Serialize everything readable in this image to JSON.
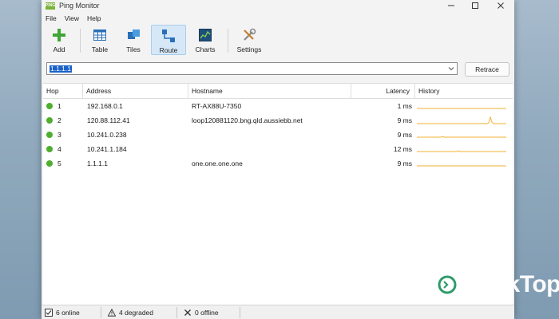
{
  "window": {
    "title": "Ping Monitor",
    "logo_text": "PING"
  },
  "menu": [
    "File",
    "View",
    "Help"
  ],
  "toolbar": [
    {
      "label": "Add",
      "icon": "plus-icon"
    },
    {
      "label": "Table",
      "icon": "table-icon"
    },
    {
      "label": "Tiles",
      "icon": "tiles-icon"
    },
    {
      "label": "Route",
      "icon": "route-icon",
      "active": true
    },
    {
      "label": "Charts",
      "icon": "chart-icon"
    },
    {
      "label": "Settings",
      "icon": "tools-icon"
    }
  ],
  "address_bar": {
    "value": "1.1.1.1",
    "retrace_label": "Retrace"
  },
  "columns": {
    "hop": "Hop",
    "address": "Address",
    "hostname": "Hostname",
    "latency": "Latency",
    "history": "History"
  },
  "hops": [
    {
      "hop": "1",
      "address": "192.168.0.1",
      "hostname": "RT-AX88U-7350",
      "latency": "1 ms"
    },
    {
      "hop": "2",
      "address": "120.88.112.41",
      "hostname": "loop120881120.bng.qld.aussiebb.net",
      "latency": "9 ms"
    },
    {
      "hop": "3",
      "address": "10.241.0.238",
      "hostname": "",
      "latency": "9 ms"
    },
    {
      "hop": "4",
      "address": "10.241.1.184",
      "hostname": "",
      "latency": "12 ms"
    },
    {
      "hop": "5",
      "address": "1.1.1.1",
      "hostname": "one.one.one.one",
      "latency": "9 ms"
    }
  ],
  "status": {
    "online": "6 online",
    "degraded": "4 degraded",
    "offline": "0 offline"
  },
  "watermark": {
    "text": "DeskTop"
  },
  "colors": {
    "online_dot": "#4fae2e",
    "history_line": "#f2b233",
    "selection": "#1b63c9"
  }
}
